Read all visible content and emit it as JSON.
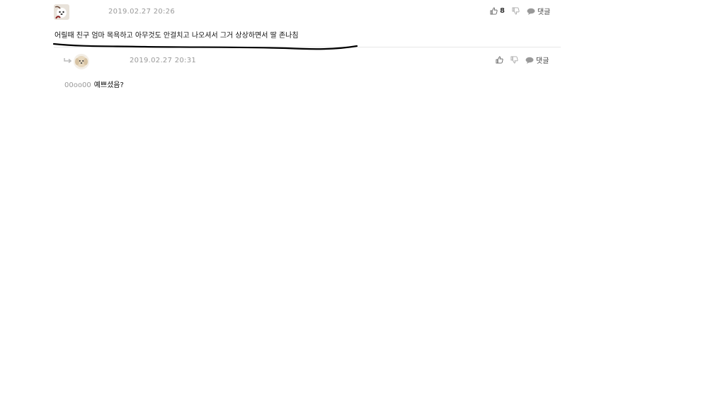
{
  "comments": [
    {
      "timestamp": "2019.02.27 20:26",
      "text": "어릴때 친구 엄마 목욕하고 아무것도 안걸치고 나오셔서 그거 상상하면서 딸 존나침",
      "like_count": "8",
      "reply_label": "댓글",
      "avatar_icon": "white-dog-avatar-icon"
    },
    {
      "timestamp": "2019.02.27 20:31",
      "mention": "00oo00",
      "text": "예쁘셨음?",
      "reply_label": "댓글",
      "avatar_icon": "puppy-avatar-icon"
    }
  ],
  "colors": {
    "timestamp": "#999999",
    "divider": "#e6e6e6",
    "icon": "#888888",
    "underline_annotation": "#000000"
  }
}
